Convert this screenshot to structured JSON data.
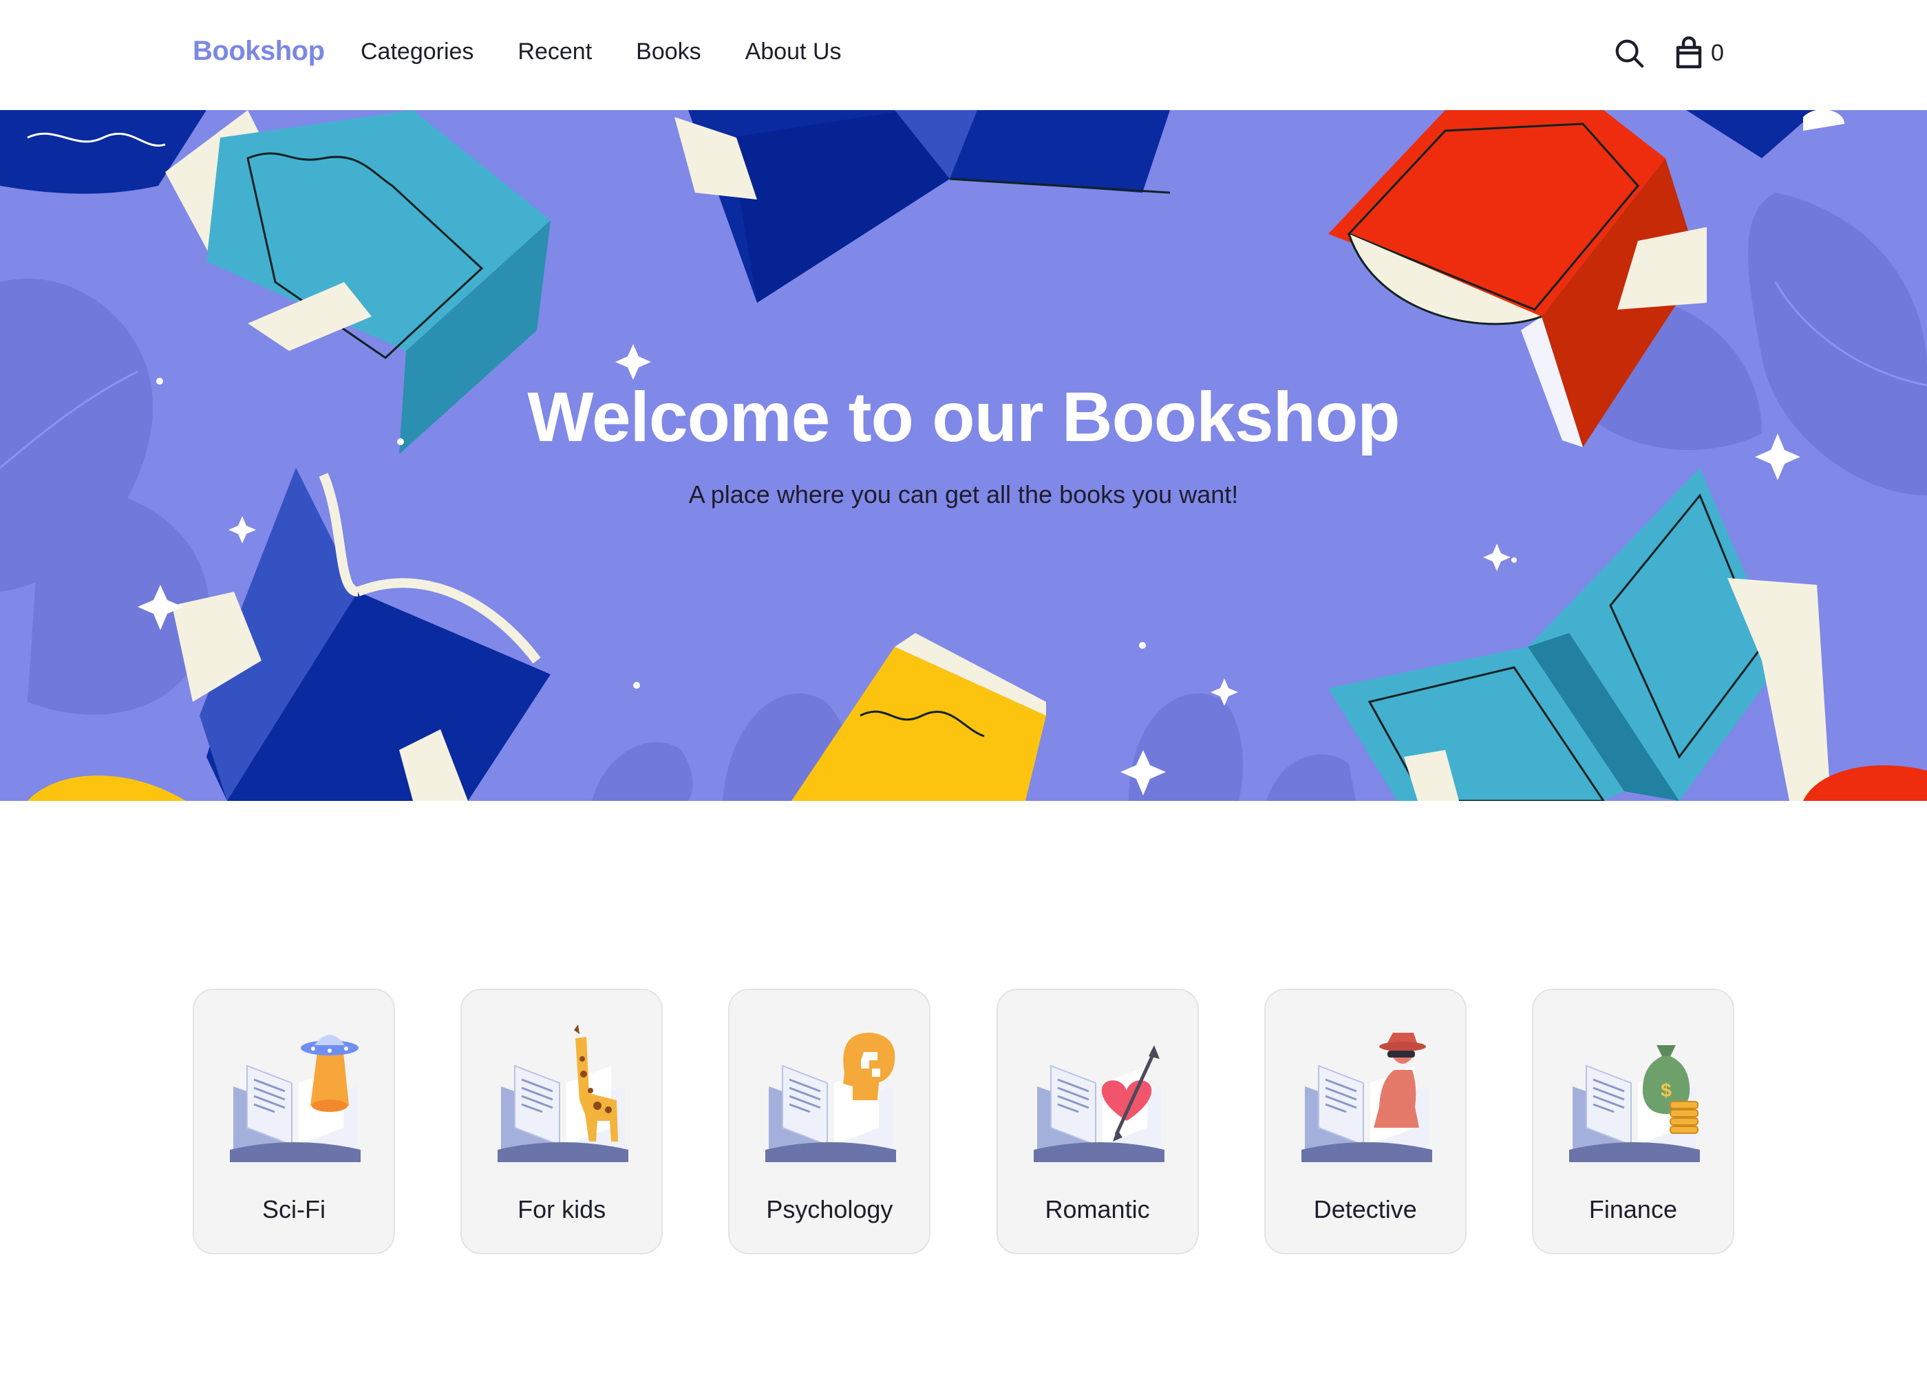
{
  "nav": {
    "brand": "Bookshop",
    "links": [
      "Categories",
      "Recent",
      "Books",
      "About Us"
    ],
    "cart_count": "0",
    "icons": [
      "search-icon",
      "shopping-bag-icon"
    ]
  },
  "hero": {
    "title": "Welcome to our Bookshop",
    "subtitle": "A place where you can get all the books you want!",
    "background": "#8088e8"
  },
  "categories": [
    {
      "label": "Sci-Fi",
      "icon": "ufo-book-icon"
    },
    {
      "label": "For kids",
      "icon": "giraffe-book-icon"
    },
    {
      "label": "Psychology",
      "icon": "head-puzzle-book-icon"
    },
    {
      "label": "Romantic",
      "icon": "heart-arrow-book-icon"
    },
    {
      "label": "Detective",
      "icon": "detective-book-icon"
    },
    {
      "label": "Finance",
      "icon": "money-bag-book-icon"
    }
  ],
  "colors": {
    "brand": "#7c88e4",
    "hero_bg": "#8088e8",
    "text": "#1d1d2c",
    "card_bg": "#f4f4f4"
  }
}
